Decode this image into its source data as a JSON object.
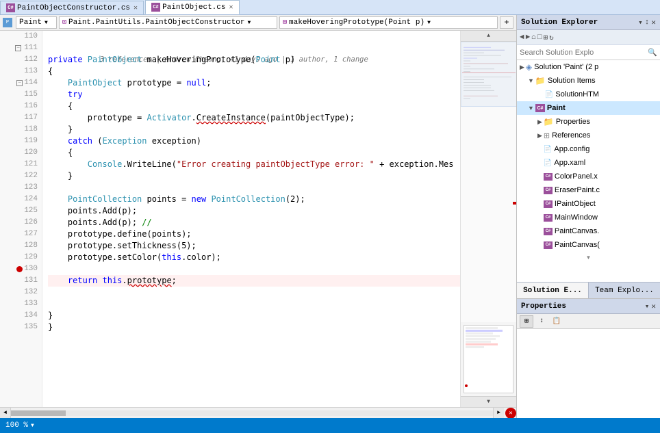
{
  "tabs": [
    {
      "label": "PaintObjectConstructor.cs",
      "active": false,
      "modified": true
    },
    {
      "label": "PaintObject.cs",
      "active": true,
      "modified": false
    }
  ],
  "toolbar": {
    "file_dropdown": "Paint",
    "namespace_dropdown": "Paint.PaintUtils.PaintObjectConstructor",
    "method_dropdown": "makeHoveringPrototype(Point p)"
  },
  "editor": {
    "meta_line": "3 references | Andrew Cheung, 41 days ago | 1 author, 1 change",
    "lines": [
      {
        "num": 110,
        "code": "",
        "indent": 8,
        "tokens": []
      },
      {
        "num": 111,
        "code": "private PaintObject makeHoveringPrototype(Point p)",
        "collapse": true
      },
      {
        "num": 112,
        "code": "{"
      },
      {
        "num": 113,
        "code": "    PaintObject prototype = null;"
      },
      {
        "num": 114,
        "code": "    try",
        "collapse": true
      },
      {
        "num": 115,
        "code": "    {"
      },
      {
        "num": 116,
        "code": "        prototype = Activator.CreateInstance(paintObjectType);"
      },
      {
        "num": 117,
        "code": "    }"
      },
      {
        "num": 118,
        "code": "    catch (Exception exception)"
      },
      {
        "num": 119,
        "code": "    {"
      },
      {
        "num": 120,
        "code": "        Console.WriteLine(\"Error creating paintObjectType error: \" + exception.Mes"
      },
      {
        "num": 121,
        "code": "    }"
      },
      {
        "num": 122,
        "code": ""
      },
      {
        "num": 123,
        "code": "    PointCollection points = new PointCollection(2);"
      },
      {
        "num": 124,
        "code": "    points.Add(p);"
      },
      {
        "num": 125,
        "code": "    points.Add(p); //"
      },
      {
        "num": 126,
        "code": "    prototype.define(points);"
      },
      {
        "num": 127,
        "code": "    prototype.setThickness(5);"
      },
      {
        "num": 128,
        "code": "    prototype.setColor(this.color);"
      },
      {
        "num": 129,
        "code": ""
      },
      {
        "num": 130,
        "code": "    return this.prototype;",
        "error": true
      },
      {
        "num": 131,
        "code": ""
      },
      {
        "num": 132,
        "code": ""
      },
      {
        "num": 133,
        "code": "}"
      },
      {
        "num": 134,
        "code": "}"
      },
      {
        "num": 135,
        "code": ""
      }
    ]
  },
  "solution_explorer": {
    "title": "Solution Explorer",
    "search_placeholder": "Search Solution Explo",
    "tree": [
      {
        "label": "Solution 'Paint' (2 p",
        "level": 0,
        "type": "solution",
        "expanded": true
      },
      {
        "label": "Solution Items",
        "level": 1,
        "type": "folder",
        "expanded": true
      },
      {
        "label": "SolutionHTM",
        "level": 2,
        "type": "file"
      },
      {
        "label": "Paint",
        "level": 1,
        "type": "project",
        "expanded": true
      },
      {
        "label": "Properties",
        "level": 2,
        "type": "folder",
        "expanded": false
      },
      {
        "label": "References",
        "level": 2,
        "type": "references",
        "expanded": false
      },
      {
        "label": "App.config",
        "level": 2,
        "type": "config"
      },
      {
        "label": "App.xaml",
        "level": 2,
        "type": "xaml"
      },
      {
        "label": "ColorPanel.x",
        "level": 2,
        "type": "cs"
      },
      {
        "label": "EraserPaint.c",
        "level": 2,
        "type": "cs"
      },
      {
        "label": "IPaintObject",
        "level": 2,
        "type": "cs"
      },
      {
        "label": "MainWindow",
        "level": 2,
        "type": "cs"
      },
      {
        "label": "PaintCanvas.",
        "level": 2,
        "type": "cs"
      },
      {
        "label": "PaintCanvas(",
        "level": 2,
        "type": "cs"
      }
    ],
    "tabs": [
      {
        "label": "Solution E...",
        "active": true
      },
      {
        "label": "Team Explo...",
        "active": false
      }
    ]
  },
  "properties": {
    "title": "Properties",
    "buttons": [
      "grid-icon",
      "sort-icon",
      "property-pages-icon"
    ]
  },
  "status_bar": {
    "zoom": "100 %",
    "position": "",
    "error_icon": "●"
  }
}
